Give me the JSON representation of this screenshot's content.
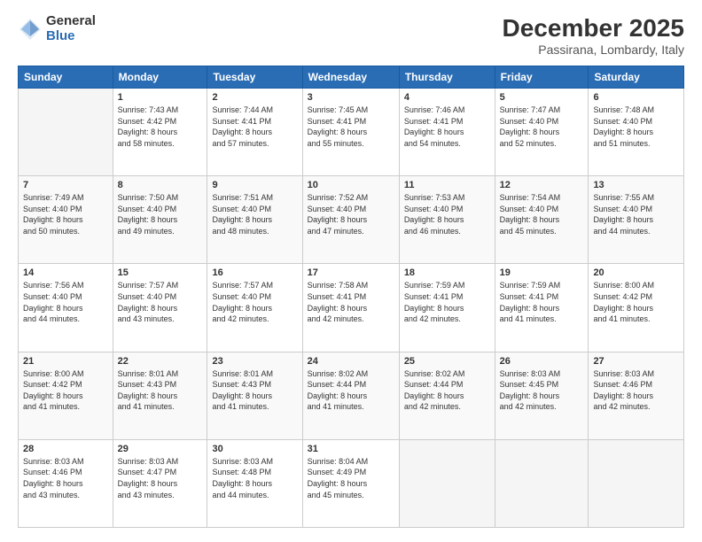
{
  "logo": {
    "general": "General",
    "blue": "Blue"
  },
  "title": "December 2025",
  "subtitle": "Passirana, Lombardy, Italy",
  "days_header": [
    "Sunday",
    "Monday",
    "Tuesday",
    "Wednesday",
    "Thursday",
    "Friday",
    "Saturday"
  ],
  "weeks": [
    [
      {
        "day": "",
        "info": ""
      },
      {
        "day": "1",
        "info": "Sunrise: 7:43 AM\nSunset: 4:42 PM\nDaylight: 8 hours\nand 58 minutes."
      },
      {
        "day": "2",
        "info": "Sunrise: 7:44 AM\nSunset: 4:41 PM\nDaylight: 8 hours\nand 57 minutes."
      },
      {
        "day": "3",
        "info": "Sunrise: 7:45 AM\nSunset: 4:41 PM\nDaylight: 8 hours\nand 55 minutes."
      },
      {
        "day": "4",
        "info": "Sunrise: 7:46 AM\nSunset: 4:41 PM\nDaylight: 8 hours\nand 54 minutes."
      },
      {
        "day": "5",
        "info": "Sunrise: 7:47 AM\nSunset: 4:40 PM\nDaylight: 8 hours\nand 52 minutes."
      },
      {
        "day": "6",
        "info": "Sunrise: 7:48 AM\nSunset: 4:40 PM\nDaylight: 8 hours\nand 51 minutes."
      }
    ],
    [
      {
        "day": "7",
        "info": "Sunrise: 7:49 AM\nSunset: 4:40 PM\nDaylight: 8 hours\nand 50 minutes."
      },
      {
        "day": "8",
        "info": "Sunrise: 7:50 AM\nSunset: 4:40 PM\nDaylight: 8 hours\nand 49 minutes."
      },
      {
        "day": "9",
        "info": "Sunrise: 7:51 AM\nSunset: 4:40 PM\nDaylight: 8 hours\nand 48 minutes."
      },
      {
        "day": "10",
        "info": "Sunrise: 7:52 AM\nSunset: 4:40 PM\nDaylight: 8 hours\nand 47 minutes."
      },
      {
        "day": "11",
        "info": "Sunrise: 7:53 AM\nSunset: 4:40 PM\nDaylight: 8 hours\nand 46 minutes."
      },
      {
        "day": "12",
        "info": "Sunrise: 7:54 AM\nSunset: 4:40 PM\nDaylight: 8 hours\nand 45 minutes."
      },
      {
        "day": "13",
        "info": "Sunrise: 7:55 AM\nSunset: 4:40 PM\nDaylight: 8 hours\nand 44 minutes."
      }
    ],
    [
      {
        "day": "14",
        "info": "Sunrise: 7:56 AM\nSunset: 4:40 PM\nDaylight: 8 hours\nand 44 minutes."
      },
      {
        "day": "15",
        "info": "Sunrise: 7:57 AM\nSunset: 4:40 PM\nDaylight: 8 hours\nand 43 minutes."
      },
      {
        "day": "16",
        "info": "Sunrise: 7:57 AM\nSunset: 4:40 PM\nDaylight: 8 hours\nand 42 minutes."
      },
      {
        "day": "17",
        "info": "Sunrise: 7:58 AM\nSunset: 4:41 PM\nDaylight: 8 hours\nand 42 minutes."
      },
      {
        "day": "18",
        "info": "Sunrise: 7:59 AM\nSunset: 4:41 PM\nDaylight: 8 hours\nand 42 minutes."
      },
      {
        "day": "19",
        "info": "Sunrise: 7:59 AM\nSunset: 4:41 PM\nDaylight: 8 hours\nand 41 minutes."
      },
      {
        "day": "20",
        "info": "Sunrise: 8:00 AM\nSunset: 4:42 PM\nDaylight: 8 hours\nand 41 minutes."
      }
    ],
    [
      {
        "day": "21",
        "info": "Sunrise: 8:00 AM\nSunset: 4:42 PM\nDaylight: 8 hours\nand 41 minutes."
      },
      {
        "day": "22",
        "info": "Sunrise: 8:01 AM\nSunset: 4:43 PM\nDaylight: 8 hours\nand 41 minutes."
      },
      {
        "day": "23",
        "info": "Sunrise: 8:01 AM\nSunset: 4:43 PM\nDaylight: 8 hours\nand 41 minutes."
      },
      {
        "day": "24",
        "info": "Sunrise: 8:02 AM\nSunset: 4:44 PM\nDaylight: 8 hours\nand 41 minutes."
      },
      {
        "day": "25",
        "info": "Sunrise: 8:02 AM\nSunset: 4:44 PM\nDaylight: 8 hours\nand 42 minutes."
      },
      {
        "day": "26",
        "info": "Sunrise: 8:03 AM\nSunset: 4:45 PM\nDaylight: 8 hours\nand 42 minutes."
      },
      {
        "day": "27",
        "info": "Sunrise: 8:03 AM\nSunset: 4:46 PM\nDaylight: 8 hours\nand 42 minutes."
      }
    ],
    [
      {
        "day": "28",
        "info": "Sunrise: 8:03 AM\nSunset: 4:46 PM\nDaylight: 8 hours\nand 43 minutes."
      },
      {
        "day": "29",
        "info": "Sunrise: 8:03 AM\nSunset: 4:47 PM\nDaylight: 8 hours\nand 43 minutes."
      },
      {
        "day": "30",
        "info": "Sunrise: 8:03 AM\nSunset: 4:48 PM\nDaylight: 8 hours\nand 44 minutes."
      },
      {
        "day": "31",
        "info": "Sunrise: 8:04 AM\nSunset: 4:49 PM\nDaylight: 8 hours\nand 45 minutes."
      },
      {
        "day": "",
        "info": ""
      },
      {
        "day": "",
        "info": ""
      },
      {
        "day": "",
        "info": ""
      }
    ]
  ]
}
